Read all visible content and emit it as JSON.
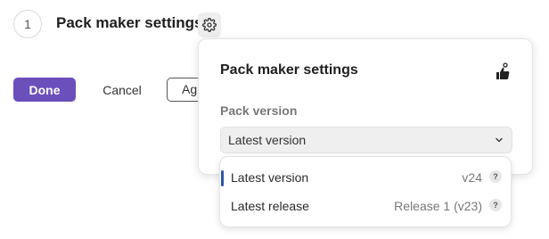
{
  "step": {
    "number": "1",
    "title": "Pack maker settings"
  },
  "actions": {
    "done_label": "Done",
    "cancel_label": "Cancel",
    "third_label": "Ag"
  },
  "popover": {
    "title": "Pack maker settings",
    "icon": "thumbs-up-icon",
    "field_label": "Pack version",
    "selected_value": "Latest version"
  },
  "dropdown": {
    "options": [
      {
        "label": "Latest version",
        "version": "v24",
        "help": "?",
        "selected": true
      },
      {
        "label": "Latest release",
        "version": "Release 1 (v23)",
        "help": "?",
        "selected": false
      }
    ]
  },
  "colors": {
    "primary": "#6b4fbb",
    "selection_bar": "#2c56a9"
  }
}
